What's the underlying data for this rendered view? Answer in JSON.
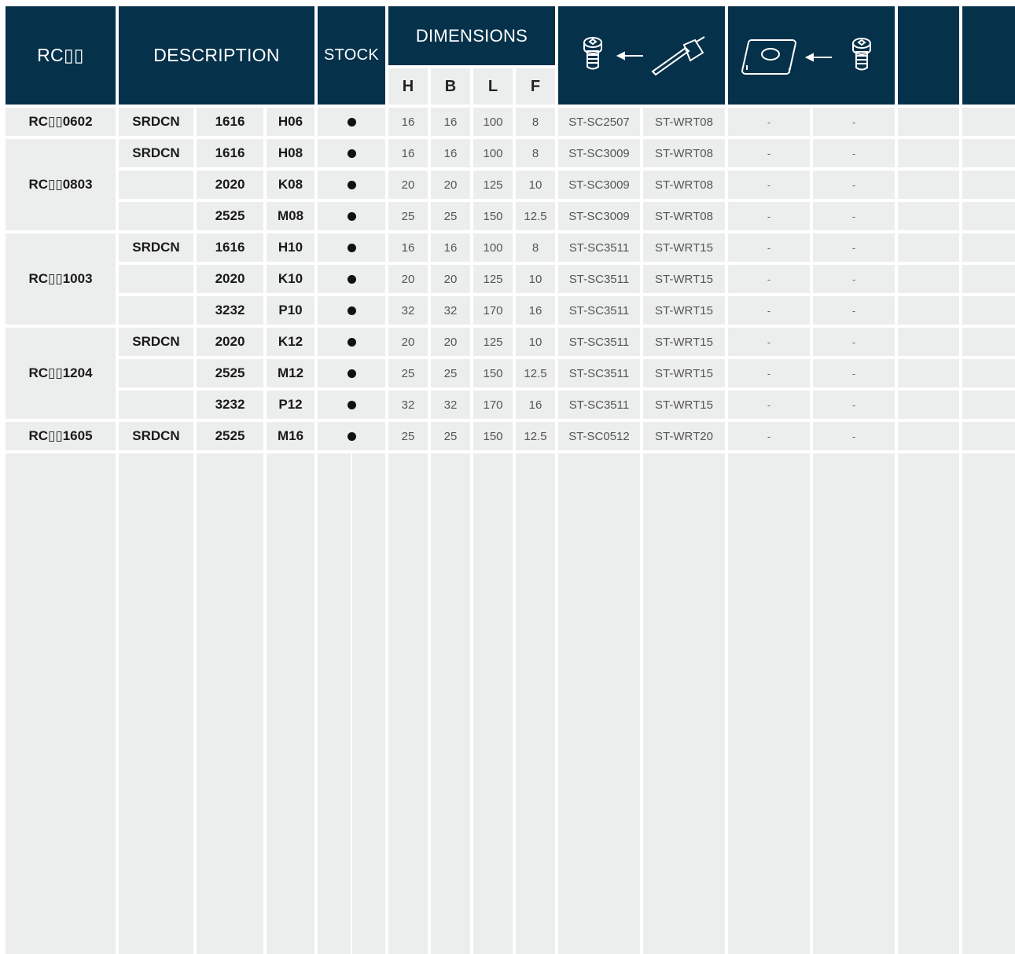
{
  "header": {
    "code": "RC▯▯",
    "description": "DESCRIPTION",
    "stock": "STOCK",
    "dimensions": "DIMENSIONS",
    "dim_cols": [
      "H",
      "B",
      "L",
      "F"
    ],
    "screw_icon": "torx-screw-icon",
    "wrench_icon": "torx-key-icon",
    "insert_icon": "square-insert-icon",
    "arrow_icon": "left-arrow-icon"
  },
  "rows": [
    {
      "code": "RC▯▯0602",
      "type": "SRDCN",
      "size": "1616",
      "suffix": "H06",
      "stock": true,
      "H": "16",
      "B": "16",
      "L": "100",
      "F": "8",
      "screw": "ST-SC2507",
      "key": "ST-WRT08",
      "c1": "-",
      "c2": "-"
    },
    {
      "code": "RC▯▯0803",
      "type": "SRDCN",
      "size": "1616",
      "suffix": "H08",
      "stock": true,
      "H": "16",
      "B": "16",
      "L": "100",
      "F": "8",
      "screw": "ST-SC3009",
      "key": "ST-WRT08",
      "c1": "-",
      "c2": "-"
    },
    {
      "code": "",
      "type": "",
      "size": "2020",
      "suffix": "K08",
      "stock": true,
      "H": "20",
      "B": "20",
      "L": "125",
      "F": "10",
      "screw": "ST-SC3009",
      "key": "ST-WRT08",
      "c1": "-",
      "c2": "-"
    },
    {
      "code": "",
      "type": "",
      "size": "2525",
      "suffix": "M08",
      "stock": true,
      "H": "25",
      "B": "25",
      "L": "150",
      "F": "12.5",
      "screw": "ST-SC3009",
      "key": "ST-WRT08",
      "c1": "-",
      "c2": "-"
    },
    {
      "code": "RC▯▯1003",
      "type": "SRDCN",
      "size": "1616",
      "suffix": "H10",
      "stock": true,
      "H": "16",
      "B": "16",
      "L": "100",
      "F": "8",
      "screw": "ST-SC3511",
      "key": "ST-WRT15",
      "c1": "-",
      "c2": "-"
    },
    {
      "code": "",
      "type": "",
      "size": "2020",
      "suffix": "K10",
      "stock": true,
      "H": "20",
      "B": "20",
      "L": "125",
      "F": "10",
      "screw": "ST-SC3511",
      "key": "ST-WRT15",
      "c1": "-",
      "c2": "-"
    },
    {
      "code": "",
      "type": "",
      "size": "3232",
      "suffix": "P10",
      "stock": true,
      "H": "32",
      "B": "32",
      "L": "170",
      "F": "16",
      "screw": "ST-SC3511",
      "key": "ST-WRT15",
      "c1": "-",
      "c2": "-"
    },
    {
      "code": "RC▯▯1204",
      "type": "SRDCN",
      "size": "2020",
      "suffix": "K12",
      "stock": true,
      "H": "20",
      "B": "20",
      "L": "125",
      "F": "10",
      "screw": "ST-SC3511",
      "key": "ST-WRT15",
      "c1": "-",
      "c2": "-"
    },
    {
      "code": "",
      "type": "",
      "size": "2525",
      "suffix": "M12",
      "stock": true,
      "H": "25",
      "B": "25",
      "L": "150",
      "F": "12.5",
      "screw": "ST-SC3511",
      "key": "ST-WRT15",
      "c1": "-",
      "c2": "-"
    },
    {
      "code": "",
      "type": "",
      "size": "3232",
      "suffix": "P12",
      "stock": true,
      "H": "32",
      "B": "32",
      "L": "170",
      "F": "16",
      "screw": "ST-SC3511",
      "key": "ST-WRT15",
      "c1": "-",
      "c2": "-"
    },
    {
      "code": "RC▯▯1605",
      "type": "SRDCN",
      "size": "2525",
      "suffix": "M16",
      "stock": true,
      "H": "25",
      "B": "25",
      "L": "150",
      "F": "12.5",
      "screw": "ST-SC0512",
      "key": "ST-WRT20",
      "c1": "-",
      "c2": "-"
    }
  ],
  "groups": [
    {
      "code": "RC▯▯0602",
      "start": 0,
      "span": 1
    },
    {
      "code": "RC▯▯0803",
      "start": 1,
      "span": 3
    },
    {
      "code": "RC▯▯1003",
      "start": 4,
      "span": 3
    },
    {
      "code": "RC▯▯1204",
      "start": 7,
      "span": 3
    },
    {
      "code": "RC▯▯1605",
      "start": 10,
      "span": 1
    }
  ],
  "colors": {
    "header": "#06314a",
    "cell": "#eceeed",
    "grid": "#ffffff"
  }
}
